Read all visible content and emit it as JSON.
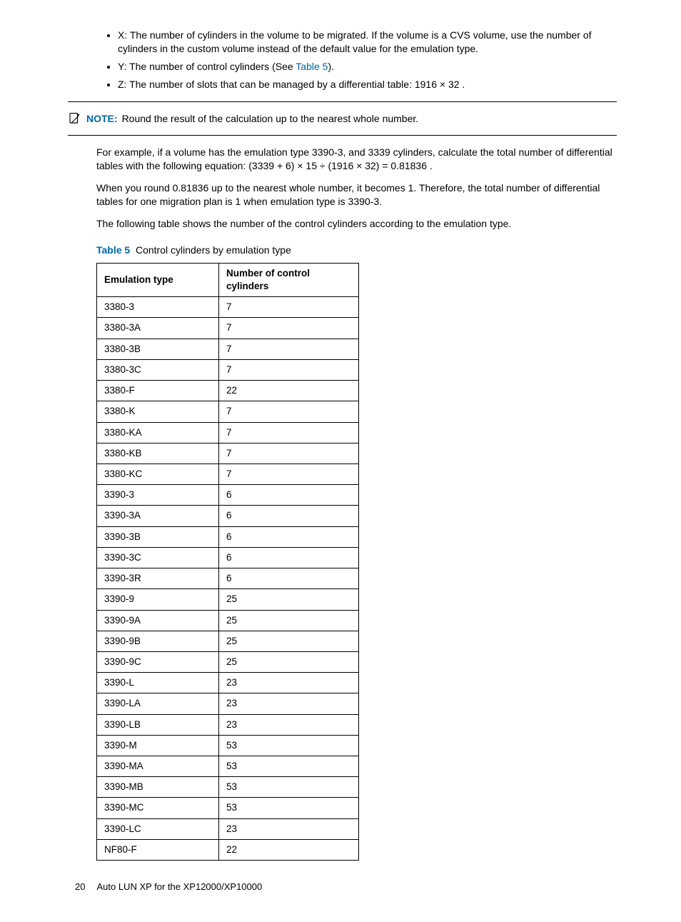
{
  "bullets": {
    "x": "X: The number of cylinders in the volume to be migrated. If the volume is a CVS volume, use the number of cylinders in the custom volume instead of the default value for the emulation type.",
    "y_pre": "Y:  The number of control cylinders (See ",
    "y_link": "Table 5",
    "y_post": ").",
    "z": "Z:  The number of slots that can be managed by a differential table:  1916 × 32 ."
  },
  "note": {
    "label": "NOTE:",
    "text": "Round the result of the calculation up to the nearest whole number."
  },
  "para1": "For example, if a volume has the emulation type 3390-3, and 3339 cylinders, calculate the total number of differential tables with the following equation:  (3339 + 6) × 15 ÷ (1916 × 32)  =  0.81836 .",
  "para2": "When you round 0.81836 up to the nearest whole number, it becomes 1. Therefore, the total number of differential tables for one migration plan is 1 when emulation type is 3390-3.",
  "para3": "The following table shows the number of the control cylinders according to the emulation type.",
  "table": {
    "label": "Table 5",
    "caption": "Control cylinders by emulation type",
    "head": {
      "c1": "Emulation type",
      "c2": "Number of control cylinders"
    },
    "rows": [
      {
        "c1": "3380-3",
        "c2": "7"
      },
      {
        "c1": "3380-3A",
        "c2": "7"
      },
      {
        "c1": "3380-3B",
        "c2": "7"
      },
      {
        "c1": "3380-3C",
        "c2": "7"
      },
      {
        "c1": "3380-F",
        "c2": "22"
      },
      {
        "c1": "3380-K",
        "c2": "7"
      },
      {
        "c1": "3380-KA",
        "c2": "7"
      },
      {
        "c1": "3380-KB",
        "c2": "7"
      },
      {
        "c1": "3380-KC",
        "c2": "7"
      },
      {
        "c1": "3390-3",
        "c2": "6"
      },
      {
        "c1": "3390-3A",
        "c2": "6"
      },
      {
        "c1": "3390-3B",
        "c2": "6"
      },
      {
        "c1": "3390-3C",
        "c2": "6"
      },
      {
        "c1": "3390-3R",
        "c2": "6"
      },
      {
        "c1": "3390-9",
        "c2": "25"
      },
      {
        "c1": "3390-9A",
        "c2": "25"
      },
      {
        "c1": "3390-9B",
        "c2": "25"
      },
      {
        "c1": "3390-9C",
        "c2": "25"
      },
      {
        "c1": "3390-L",
        "c2": "23"
      },
      {
        "c1": "3390-LA",
        "c2": "23"
      },
      {
        "c1": "3390-LB",
        "c2": "23"
      },
      {
        "c1": "3390-M",
        "c2": "53"
      },
      {
        "c1": "3390-MA",
        "c2": "53"
      },
      {
        "c1": "3390-MB",
        "c2": "53"
      },
      {
        "c1": "3390-MC",
        "c2": "53"
      },
      {
        "c1": "3390-LC",
        "c2": "23"
      },
      {
        "c1": "NF80-F",
        "c2": "22"
      }
    ]
  },
  "footer": {
    "page": "20",
    "title": "Auto LUN XP for the XP12000/XP10000"
  }
}
